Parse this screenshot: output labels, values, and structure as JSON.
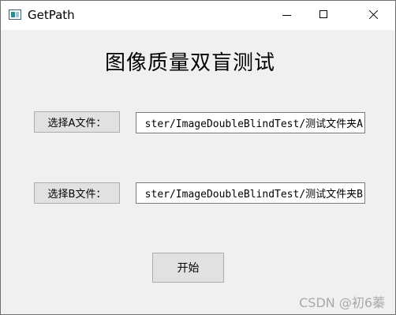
{
  "window": {
    "title": "GetPath"
  },
  "main": {
    "heading": "图像质量双盲测试",
    "select_a_label": "选择A文件：",
    "path_a": "ster/ImageDoubleBlindTest/测试文件夹A",
    "select_b_label": "选择B文件：",
    "path_b": "ster/ImageDoubleBlindTest/测试文件夹B",
    "start_label": "开始"
  },
  "watermark": "CSDN @初6蓁"
}
